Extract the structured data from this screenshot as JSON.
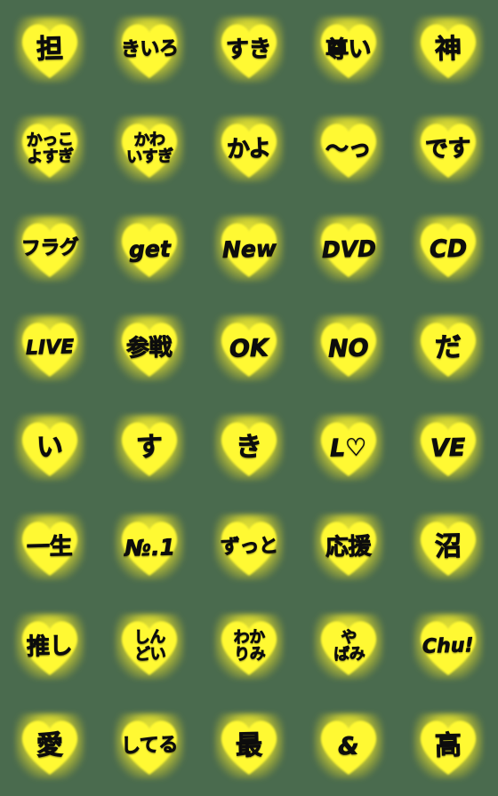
{
  "sheet": {
    "title": "Yellow Heart Emoji Sheet",
    "background_color": "#4a6b4e",
    "heart_color": "#fff933",
    "text_color": "#0d0d0d",
    "columns": 5,
    "rows": 8,
    "total_items": 40
  },
  "items": [
    {
      "id": "r1c1",
      "text": "担",
      "style": "g-1",
      "row": 1,
      "col": 1
    },
    {
      "id": "r1c2",
      "text": "きいろ",
      "style": "g-3",
      "row": 1,
      "col": 2
    },
    {
      "id": "r1c3",
      "text": "すき",
      "style": "g-2",
      "row": 1,
      "col": 3
    },
    {
      "id": "r1c4",
      "text": "尊い",
      "style": "g-2",
      "row": 1,
      "col": 4
    },
    {
      "id": "r1c5",
      "text": "神",
      "style": "g-1",
      "row": 1,
      "col": 5
    },
    {
      "id": "r2c1",
      "text": "かっこ\nよすぎ",
      "style": "g-2l",
      "row": 2,
      "col": 1
    },
    {
      "id": "r2c2",
      "text": "かわ\nいすぎ",
      "style": "g-2l",
      "row": 2,
      "col": 2
    },
    {
      "id": "r2c3",
      "text": "かよ",
      "style": "g-2",
      "row": 2,
      "col": 3
    },
    {
      "id": "r2c4",
      "text": "〜っ",
      "style": "g-2",
      "row": 2,
      "col": 4
    },
    {
      "id": "r2c5",
      "text": "です",
      "style": "g-2",
      "row": 2,
      "col": 5
    },
    {
      "id": "r3c1",
      "text": "フラグ",
      "style": "g-3",
      "row": 3,
      "col": 1
    },
    {
      "id": "r3c2",
      "text": "get",
      "style": "lat-3",
      "row": 3,
      "col": 2
    },
    {
      "id": "r3c3",
      "text": "New",
      "style": "lat-3",
      "row": 3,
      "col": 3
    },
    {
      "id": "r3c4",
      "text": "DVD",
      "style": "lat-3",
      "row": 3,
      "col": 4
    },
    {
      "id": "r3c5",
      "text": "CD",
      "style": "lat-2",
      "row": 3,
      "col": 5
    },
    {
      "id": "r4c1",
      "text": "LIVE",
      "style": "lat-4",
      "row": 4,
      "col": 1
    },
    {
      "id": "r4c2",
      "text": "参戦",
      "style": "g-2",
      "row": 4,
      "col": 2
    },
    {
      "id": "r4c3",
      "text": "OK",
      "style": "lat-2",
      "row": 4,
      "col": 3
    },
    {
      "id": "r4c4",
      "text": "NO",
      "style": "lat-2",
      "row": 4,
      "col": 4
    },
    {
      "id": "r4c5",
      "text": "だ",
      "style": "g-1",
      "row": 4,
      "col": 5
    },
    {
      "id": "r5c1",
      "text": "い",
      "style": "g-1",
      "row": 5,
      "col": 1
    },
    {
      "id": "r5c2",
      "text": "す",
      "style": "g-1",
      "row": 5,
      "col": 2
    },
    {
      "id": "r5c3",
      "text": "き",
      "style": "g-1",
      "row": 5,
      "col": 3
    },
    {
      "id": "r5c4",
      "text": "L♡",
      "style": "lat-2",
      "row": 5,
      "col": 4
    },
    {
      "id": "r5c5",
      "text": "VE",
      "style": "lat-2",
      "row": 5,
      "col": 5
    },
    {
      "id": "r6c1",
      "text": "一生",
      "style": "g-2",
      "row": 6,
      "col": 1
    },
    {
      "id": "r6c2",
      "text": "№.1",
      "style": "lat-3",
      "row": 6,
      "col": 2
    },
    {
      "id": "r6c3",
      "text": "ずっと",
      "style": "g-3",
      "row": 6,
      "col": 3
    },
    {
      "id": "r6c4",
      "text": "応援",
      "style": "g-2",
      "row": 6,
      "col": 4
    },
    {
      "id": "r6c5",
      "text": "沼",
      "style": "g-1",
      "row": 6,
      "col": 5
    },
    {
      "id": "r7c1",
      "text": "推し",
      "style": "g-2",
      "row": 7,
      "col": 1
    },
    {
      "id": "r7c2",
      "text": "しん\nどい",
      "style": "g-2l",
      "row": 7,
      "col": 2
    },
    {
      "id": "r7c3",
      "text": "わか\nりみ",
      "style": "g-2l",
      "row": 7,
      "col": 3
    },
    {
      "id": "r7c4",
      "text": "や\nばみ",
      "style": "g-2l",
      "row": 7,
      "col": 4
    },
    {
      "id": "r7c5",
      "text": "Chu!",
      "style": "lat-4",
      "row": 7,
      "col": 5
    },
    {
      "id": "r8c1",
      "text": "愛",
      "style": "g-1",
      "row": 8,
      "col": 1
    },
    {
      "id": "r8c2",
      "text": "してる",
      "style": "g-3",
      "row": 8,
      "col": 2
    },
    {
      "id": "r8c3",
      "text": "最",
      "style": "g-1",
      "row": 8,
      "col": 3
    },
    {
      "id": "r8c4",
      "text": "&",
      "style": "lat-2",
      "row": 8,
      "col": 4
    },
    {
      "id": "r8c5",
      "text": "高",
      "style": "g-1",
      "row": 8,
      "col": 5
    }
  ]
}
